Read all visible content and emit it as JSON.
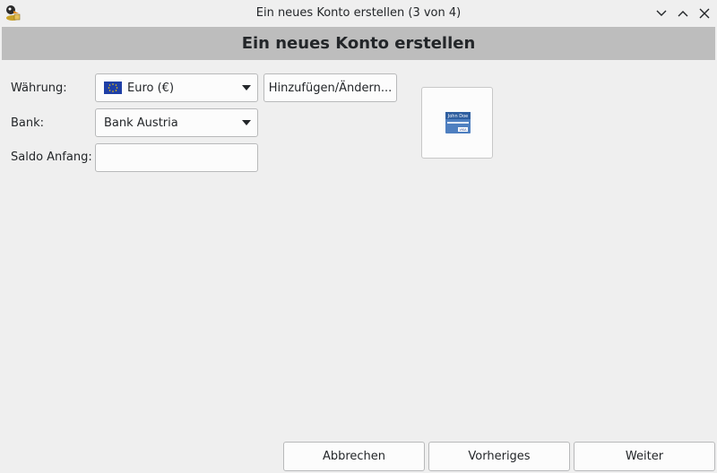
{
  "window": {
    "title": "Ein neues Konto erstellen (3 von 4)",
    "app_icon": "kmymoney-icon",
    "controls": [
      "minimize-icon",
      "maximize-icon",
      "close-icon"
    ]
  },
  "banner": {
    "title": "Ein neues Konto erstellen"
  },
  "form": {
    "currency_label": "Währung:",
    "currency_value": "Euro (€)",
    "currency_flag": "eu-flag-icon",
    "add_change_button": "Hinzufügen/Ändern...",
    "bank_label": "Bank:",
    "bank_value": "Bank Austria",
    "opening_balance_label": "Saldo Anfang:",
    "opening_balance_value": ""
  },
  "preview": {
    "card_name": "John Doe",
    "card_brand": "VISA",
    "icon": "credit-card-icon"
  },
  "footer": {
    "cancel": "Abbrechen",
    "back": "Vorheriges",
    "next": "Weiter"
  },
  "colors": {
    "window_bg": "#efefef",
    "banner_bg": "#bdbdbd",
    "field_bg": "#fcfcfc",
    "border": "#b8b9ba",
    "flag_blue": "#1f3fa6",
    "flag_star": "#ffcc00"
  }
}
